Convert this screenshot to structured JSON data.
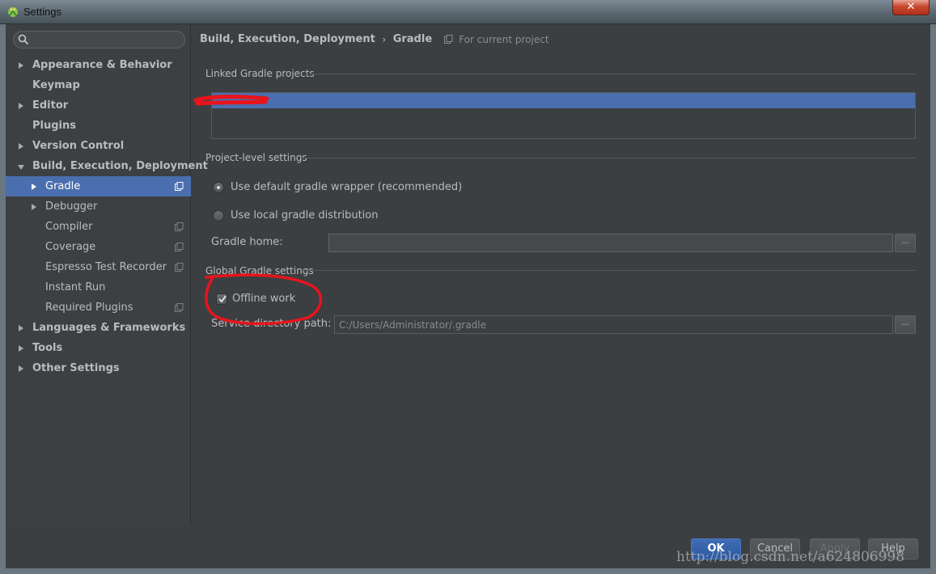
{
  "window": {
    "title": "Settings",
    "close_glyph": "✕"
  },
  "search": {
    "placeholder": "",
    "value": ""
  },
  "sidebar": {
    "items": [
      {
        "label": "Appearance & Behavior"
      },
      {
        "label": "Keymap"
      },
      {
        "label": "Editor"
      },
      {
        "label": "Plugins"
      },
      {
        "label": "Version Control"
      },
      {
        "label": "Build, Execution, Deployment"
      },
      {
        "label": "Gradle"
      },
      {
        "label": "Debugger"
      },
      {
        "label": "Compiler"
      },
      {
        "label": "Coverage"
      },
      {
        "label": "Espresso Test Recorder"
      },
      {
        "label": "Instant Run"
      },
      {
        "label": "Required Plugins"
      },
      {
        "label": "Languages & Frameworks"
      },
      {
        "label": "Tools"
      },
      {
        "label": "Other Settings"
      }
    ],
    "selected": "Gradle"
  },
  "breadcrumb": {
    "parent": "Build, Execution, Deployment",
    "separator": "›",
    "current": "Gradle",
    "scope": "For current project"
  },
  "linked_projects": {
    "title": "Linked Gradle projects",
    "items": [
      ""
    ]
  },
  "project_level": {
    "title": "Project-level settings",
    "option_default": "Use default gradle wrapper (recommended)",
    "option_local": "Use local gradle distribution",
    "selected": "default",
    "gradle_home_label": "Gradle home:",
    "gradle_home_value": "",
    "browse_label": "..."
  },
  "global": {
    "title": "Global Gradle settings",
    "offline_label": "Offline work",
    "offline_checked": true,
    "service_dir_label": "Service directory path:",
    "service_dir_value": "C:/Users/Administrator/.gradle",
    "browse_label": "..."
  },
  "buttons": {
    "ok": "OK",
    "cancel": "Cancel",
    "apply": "Apply",
    "help": "Help"
  },
  "watermark": "http://blog.csdn.net/a624806998",
  "colors": {
    "background": "#3c3f41",
    "selection": "#4b6eaf",
    "text": "#bbbbbb",
    "annotation_red": "#e8141c"
  }
}
